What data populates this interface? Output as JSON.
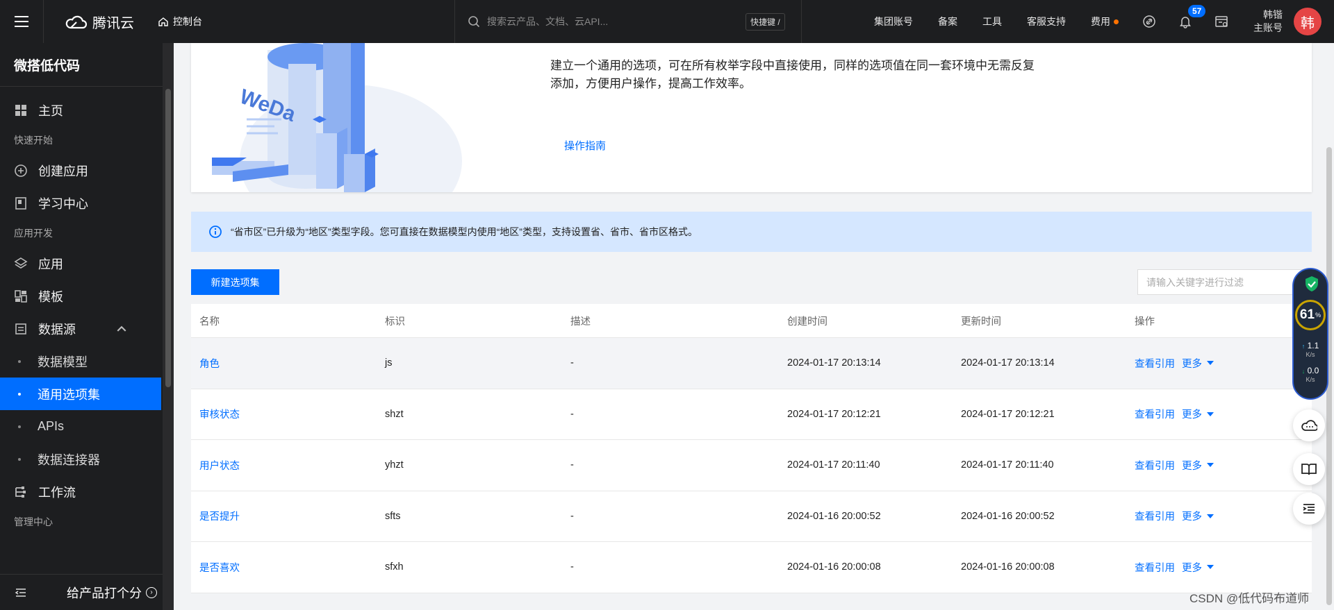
{
  "topbar": {
    "brand": "腾讯云",
    "console": "控制台",
    "search_placeholder": "搜索云产品、文档、云API...",
    "shortcut": "快捷键 /",
    "links": [
      "集团账号",
      "备案",
      "工具",
      "客服支持",
      "费用"
    ],
    "notification_count": "57",
    "user_name": "韩锴",
    "user_role": "主账号",
    "avatar_char": "韩"
  },
  "sidebar": {
    "title": "微搭低代码",
    "home": "主页",
    "section_quick": "快速开始",
    "create_app": "创建应用",
    "learn": "学习中心",
    "section_dev": "应用开发",
    "apps": "应用",
    "templates": "模板",
    "datasource": "数据源",
    "sub_items": [
      "数据模型",
      "通用选项集",
      "APIs",
      "数据连接器"
    ],
    "workflow": "工作流",
    "section_admin": "管理中心",
    "rate": "给产品打个分"
  },
  "banner": {
    "illustration_text": "WeDa",
    "description": "建立一个通用的选项，可在所有枚举字段中直接使用，同样的选项值在同一套环境中无需反复添加，方便用户操作，提高工作效率。",
    "guide_link": "操作指南"
  },
  "notice": "“省市区”已升级为“地区”类型字段。您可直接在数据模型内使用“地区”类型，支持设置省、省市、省市区格式。",
  "toolbar": {
    "create_button": "新建选项集",
    "filter_placeholder": "请输入关键字进行过滤"
  },
  "table": {
    "headers": [
      "名称",
      "标识",
      "描述",
      "创建时间",
      "更新时间",
      "操作"
    ],
    "rows": [
      {
        "name": "角色",
        "id": "js",
        "desc": "-",
        "created": "2024-01-17 20:13:14",
        "updated": "2024-01-17 20:13:14"
      },
      {
        "name": "审核状态",
        "id": "shzt",
        "desc": "-",
        "created": "2024-01-17 20:12:21",
        "updated": "2024-01-17 20:12:21"
      },
      {
        "name": "用户状态",
        "id": "yhzt",
        "desc": "-",
        "created": "2024-01-17 20:11:40",
        "updated": "2024-01-17 20:11:40"
      },
      {
        "name": "是否提升",
        "id": "sfts",
        "desc": "-",
        "created": "2024-01-16 20:00:52",
        "updated": "2024-01-16 20:00:52"
      },
      {
        "name": "是否喜欢",
        "id": "sfxh",
        "desc": "-",
        "created": "2024-01-16 20:00:08",
        "updated": "2024-01-16 20:00:08"
      }
    ],
    "op_view": "查看引用",
    "op_more": "更多"
  },
  "monitor": {
    "cpu": "61",
    "cpu_unit": "%",
    "up": "1.1",
    "down": "0.0",
    "unit": "K/s"
  },
  "watermark": "CSDN @低代码布道师",
  "colors": {
    "accent": "#006eff",
    "topbar": "#1d1e20",
    "notice_bg": "#d5e7ff"
  }
}
